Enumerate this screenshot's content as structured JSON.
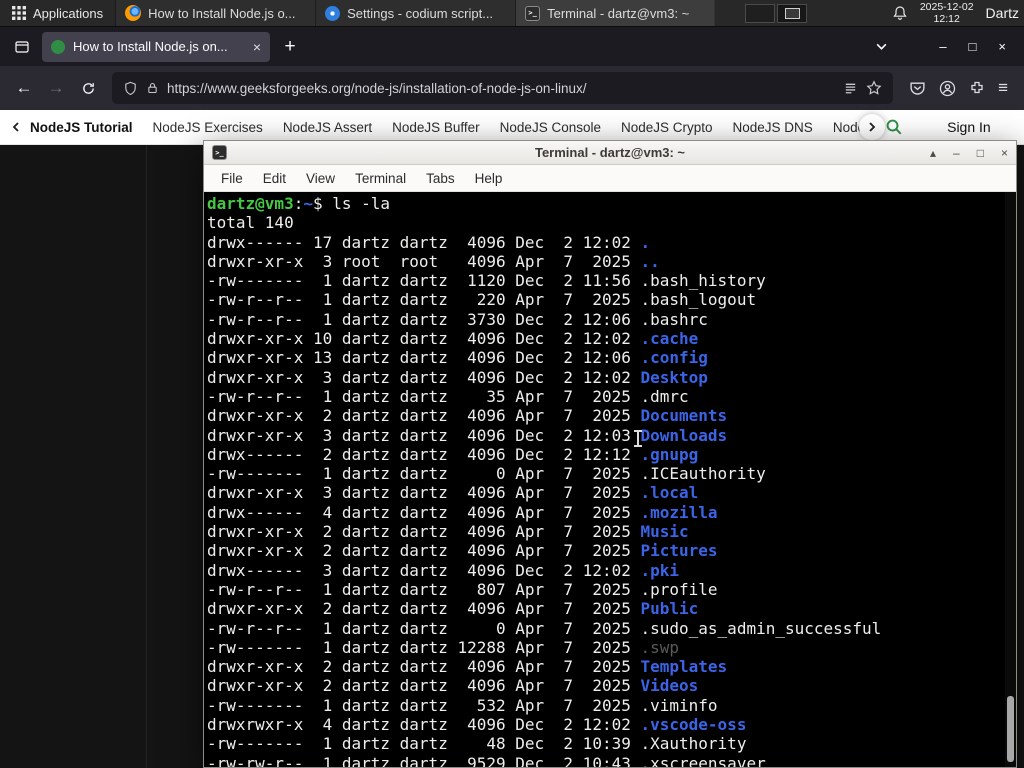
{
  "panel": {
    "applications_label": "Applications",
    "tasks": [
      {
        "label": "How to Install Node.js o...",
        "icon": "firefox-icon"
      },
      {
        "label": "Settings - codium script...",
        "icon": "settings-icon"
      },
      {
        "label": "Terminal - dartz@vm3: ~",
        "icon": "terminal-icon"
      }
    ],
    "clock_date": "2025-12-02",
    "clock_time": "12:12",
    "user_label": "Dartz"
  },
  "browser": {
    "tab_title": "How to Install Node.js on...",
    "url": "https://www.geeksforgeeks.org/node-js/installation-of-node-js-on-linux/"
  },
  "glyphs": {
    "back": "←",
    "forward": "→",
    "new_tab": "+",
    "close_tab": "×",
    "window_minimize": "–",
    "window_maximize": "□",
    "window_close": "×",
    "hamburger": "≡",
    "terminal_shade": "▴",
    "terminal_minimize": "–",
    "terminal_maximize": "□",
    "terminal_close": "×"
  },
  "site_nav": {
    "items": [
      "NodeJS Tutorial",
      "NodeJS Exercises",
      "NodeJS Assert",
      "NodeJS Buffer",
      "NodeJS Console",
      "NodeJS Crypto",
      "NodeJS DNS",
      "Node"
    ],
    "sign_in_label": "Sign In"
  },
  "terminal": {
    "window_title": "Terminal - dartz@vm3: ~",
    "menus": [
      "File",
      "Edit",
      "View",
      "Terminal",
      "Tabs",
      "Help"
    ],
    "prompt_userhost": "dartz@vm3",
    "prompt_separator": ":",
    "prompt_path": "~",
    "prompt_symbol": "$",
    "command": "ls -la",
    "total_line": "total 140",
    "listing": [
      {
        "pre": "drwx------ 17 dartz dartz  4096 Dec  2 12:02 ",
        "name": ".",
        "type": "dir"
      },
      {
        "pre": "drwxr-xr-x  3 root  root   4096 Apr  7  2025 ",
        "name": "..",
        "type": "dir"
      },
      {
        "pre": "-rw-------  1 dartz dartz  1120 Dec  2 11:56 ",
        "name": ".bash_history",
        "type": "file"
      },
      {
        "pre": "-rw-r--r--  1 dartz dartz   220 Apr  7  2025 ",
        "name": ".bash_logout",
        "type": "file"
      },
      {
        "pre": "-rw-r--r--  1 dartz dartz  3730 Dec  2 12:06 ",
        "name": ".bashrc",
        "type": "file"
      },
      {
        "pre": "drwxr-xr-x 10 dartz dartz  4096 Dec  2 12:02 ",
        "name": ".cache",
        "type": "dir"
      },
      {
        "pre": "drwxr-xr-x 13 dartz dartz  4096 Dec  2 12:06 ",
        "name": ".config",
        "type": "dir"
      },
      {
        "pre": "drwxr-xr-x  3 dartz dartz  4096 Dec  2 12:02 ",
        "name": "Desktop",
        "type": "dir"
      },
      {
        "pre": "-rw-r--r--  1 dartz dartz    35 Apr  7  2025 ",
        "name": ".dmrc",
        "type": "file"
      },
      {
        "pre": "drwxr-xr-x  2 dartz dartz  4096 Apr  7  2025 ",
        "name": "Documents",
        "type": "dir"
      },
      {
        "pre": "drwxr-xr-x  3 dartz dartz  4096 Dec  2 12:03 ",
        "name": "Downloads",
        "type": "dir"
      },
      {
        "pre": "drwx------  2 dartz dartz  4096 Dec  2 12:12 ",
        "name": ".gnupg",
        "type": "dir"
      },
      {
        "pre": "-rw-------  1 dartz dartz     0 Apr  7  2025 ",
        "name": ".ICEauthority",
        "type": "file"
      },
      {
        "pre": "drwxr-xr-x  3 dartz dartz  4096 Apr  7  2025 ",
        "name": ".local",
        "type": "dir"
      },
      {
        "pre": "drwx------  4 dartz dartz  4096 Apr  7  2025 ",
        "name": ".mozilla",
        "type": "dir"
      },
      {
        "pre": "drwxr-xr-x  2 dartz dartz  4096 Apr  7  2025 ",
        "name": "Music",
        "type": "dir"
      },
      {
        "pre": "drwxr-xr-x  2 dartz dartz  4096 Apr  7  2025 ",
        "name": "Pictures",
        "type": "dir"
      },
      {
        "pre": "drwx------  3 dartz dartz  4096 Dec  2 12:02 ",
        "name": ".pki",
        "type": "dir"
      },
      {
        "pre": "-rw-r--r--  1 dartz dartz   807 Apr  7  2025 ",
        "name": ".profile",
        "type": "file"
      },
      {
        "pre": "drwxr-xr-x  2 dartz dartz  4096 Apr  7  2025 ",
        "name": "Public",
        "type": "dir"
      },
      {
        "pre": "-rw-r--r--  1 dartz dartz     0 Apr  7  2025 ",
        "name": ".sudo_as_admin_successful",
        "type": "file"
      },
      {
        "pre": "-rw-------  1 dartz dartz 12288 Apr  7  2025 ",
        "name": ".swp",
        "type": "dim"
      },
      {
        "pre": "drwxr-xr-x  2 dartz dartz  4096 Apr  7  2025 ",
        "name": "Templates",
        "type": "dir"
      },
      {
        "pre": "drwxr-xr-x  2 dartz dartz  4096 Apr  7  2025 ",
        "name": "Videos",
        "type": "dir"
      },
      {
        "pre": "-rw-------  1 dartz dartz   532 Apr  7  2025 ",
        "name": ".viminfo",
        "type": "file"
      },
      {
        "pre": "drwxrwxr-x  4 dartz dartz  4096 Dec  2 12:02 ",
        "name": ".vscode-oss",
        "type": "dir"
      },
      {
        "pre": "-rw-------  1 dartz dartz    48 Dec  2 10:39 ",
        "name": ".Xauthority",
        "type": "file"
      },
      {
        "pre": "-rw-rw-r--  1 dartz dartz  9529 Dec  2 10:43 ",
        "name": ".xscreensaver",
        "type": "file"
      }
    ]
  },
  "colors": {
    "dir_blue": "#3b64e6",
    "prompt_green": "#45c945",
    "gfg_green": "#2f8d46",
    "firefox_dark": "#1c1b22"
  }
}
